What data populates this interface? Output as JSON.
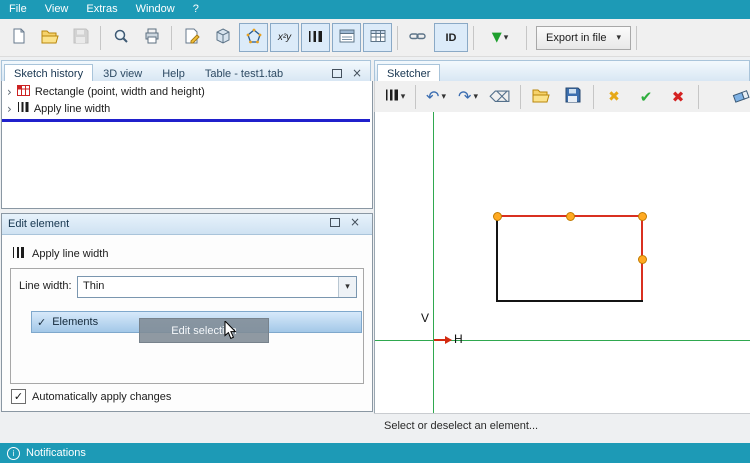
{
  "menu": {
    "items": [
      "File",
      "View",
      "Extras",
      "Window",
      "?"
    ]
  },
  "toolbar": {
    "id_label": "ID",
    "formula_label": "x²y",
    "export_label": "Export in file"
  },
  "glyphs": {
    "dropdown": "▾",
    "undo": "↶",
    "redo": "↷",
    "backspace": "⌫",
    "apply_check": "✔",
    "cancel_cross": "✖",
    "discard_cross": "✖",
    "green_arrow": "▼",
    "expander": "›",
    "check": "✓",
    "close": "×"
  },
  "history_panel": {
    "tabs": [
      "Sketch history",
      "3D view",
      "Help",
      "Table - test1.tab"
    ],
    "items": [
      "Rectangle (point, width and height)",
      "Apply line width"
    ]
  },
  "edit_panel": {
    "title": "Edit element",
    "header": "Apply line width",
    "line_width_label": "Line width:",
    "line_width_value": "Thin",
    "elements_label": "Elements",
    "drag_tooltip": "Edit selection",
    "auto_apply_label": "Automatically apply changes",
    "auto_apply_checked": true
  },
  "sketcher": {
    "tab_label": "Sketcher",
    "axis_v_label": "V",
    "axis_h_label": "H",
    "status_text": "Select or deselect an element..."
  },
  "notifications": {
    "title": "Notifications"
  },
  "colors": {
    "titlebar_teal": "#1d9ab6",
    "selection_blue": "#2020cc",
    "axis_green": "#2fa84f",
    "selected_edge_red": "#d93020",
    "handle_orange": "#ffaa22"
  }
}
